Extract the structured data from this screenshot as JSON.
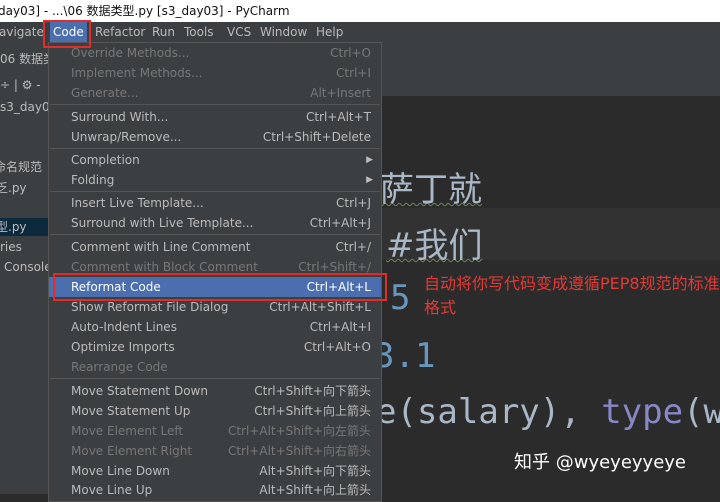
{
  "window": {
    "title": "day03] - ...\\06 数据类型.py [s3_day03] - PyCharm"
  },
  "menubar": {
    "items": [
      "avigate",
      "Code",
      "Refactor",
      "Run",
      "Tools",
      "VCS",
      "Window",
      "Help"
    ],
    "active": "Code"
  },
  "left_panel": {
    "tab_label": "06 数据类型",
    "toolbar": "÷ | ⚙ -",
    "items": [
      "s3_day03",
      "命名规范",
      "乏.py",
      "型.py",
      "ries",
      "Console"
    ],
    "selected": "型.py"
  },
  "code_menu": {
    "items": [
      {
        "label": "Override Methods...",
        "shortcut": "Ctrl+O",
        "disabled": true
      },
      {
        "label": "Implement Methods...",
        "shortcut": "Ctrl+I",
        "disabled": true
      },
      {
        "label": "Generate...",
        "shortcut": "Alt+Insert",
        "disabled": true
      },
      {
        "label": "Surround With...",
        "shortcut": "Ctrl+Alt+T",
        "disabled": false
      },
      {
        "label": "Unwrap/Remove...",
        "shortcut": "Ctrl+Shift+Delete",
        "disabled": false
      },
      {
        "label": "Completion",
        "shortcut": "",
        "disabled": false,
        "submenu": true
      },
      {
        "label": "Folding",
        "shortcut": "",
        "disabled": false,
        "submenu": true
      },
      {
        "label": "Insert Live Template...",
        "shortcut": "Ctrl+J",
        "disabled": false
      },
      {
        "label": "Surround with Live Template...",
        "shortcut": "Ctrl+Alt+J",
        "disabled": false
      },
      {
        "label": "Comment with Line Comment",
        "shortcut": "Ctrl+/",
        "disabled": false
      },
      {
        "label": "Comment with Block Comment",
        "shortcut": "Ctrl+Shift+/",
        "disabled": true
      },
      {
        "label": "Reformat Code",
        "shortcut": "Ctrl+Alt+L",
        "disabled": false,
        "focused": true
      },
      {
        "label": "Show Reformat File Dialog",
        "shortcut": "Ctrl+Alt+Shift+L",
        "disabled": false
      },
      {
        "label": "Auto-Indent Lines",
        "shortcut": "Ctrl+Alt+I",
        "disabled": false
      },
      {
        "label": "Optimize Imports",
        "shortcut": "Ctrl+Alt+O",
        "disabled": false
      },
      {
        "label": "Rearrange Code",
        "shortcut": "",
        "disabled": true
      },
      {
        "label": "Move Statement Down",
        "shortcut": "Ctrl+Shift+向下箭头",
        "disabled": false
      },
      {
        "label": "Move Statement Up",
        "shortcut": "Ctrl+Shift+向上箭头",
        "disabled": false
      },
      {
        "label": "Move Element Left",
        "shortcut": "Ctrl+Alt+Shift+向左箭头",
        "disabled": true
      },
      {
        "label": "Move Element Right",
        "shortcut": "Ctrl+Alt+Shift+向右箭头",
        "disabled": true
      },
      {
        "label": "Move Line Down",
        "shortcut": "Alt+Shift+向下箭头",
        "disabled": false
      },
      {
        "label": "Move Line Up",
        "shortcut": "Alt+Shift+向上箭头",
        "disabled": false
      }
    ]
  },
  "editor": {
    "line1": "萨丁就",
    "line2": "#我们",
    "line3": "5",
    "line4": "3.1",
    "line5_a": "e(salary),",
    "line5_b": "type",
    "line5_c": "(we"
  },
  "annotation": "自动将你写代码变成遵循PEP8规范的标准格式",
  "watermark": "知乎 @wyeyeyyeye",
  "colors": {
    "menu_bg": "#3c3f41",
    "focus": "#4b6eaf",
    "highlight_box": "#e32b2b",
    "annotation": "#e53935"
  }
}
